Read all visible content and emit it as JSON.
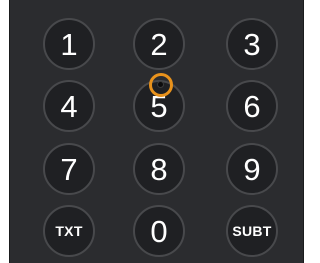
{
  "keypad": {
    "keys": [
      {
        "label": "1"
      },
      {
        "label": "2"
      },
      {
        "label": "3"
      },
      {
        "label": "4"
      },
      {
        "label": "5"
      },
      {
        "label": "6"
      },
      {
        "label": "7"
      },
      {
        "label": "8"
      },
      {
        "label": "9"
      },
      {
        "label": "TXT"
      },
      {
        "label": "0"
      },
      {
        "label": "SUBT"
      }
    ]
  },
  "colors": {
    "remote_body": "#2b2c2f",
    "key_face": "#1f2023",
    "key_border": "#48494c",
    "key_text": "#ffffff",
    "focus_ring": "#e8921c"
  }
}
